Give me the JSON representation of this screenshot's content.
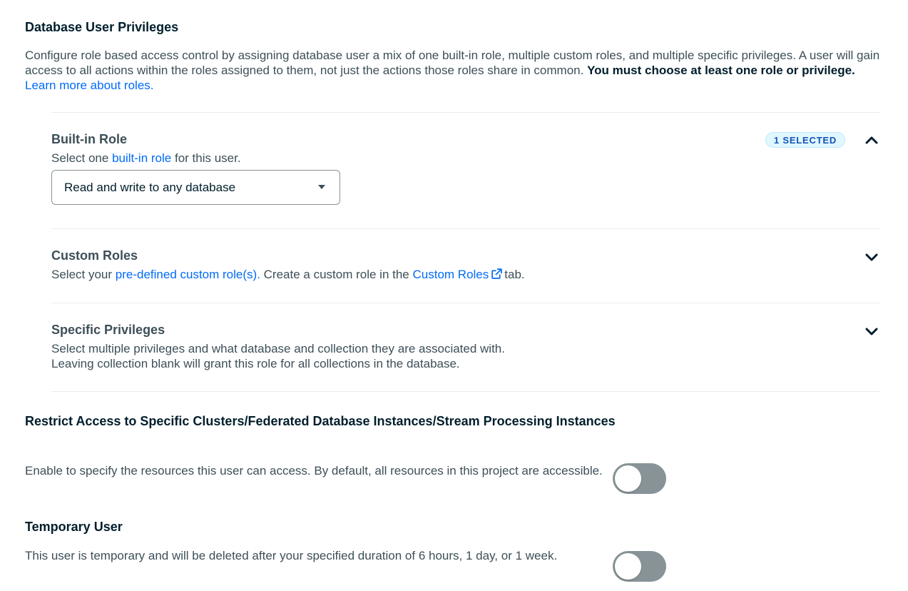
{
  "header": {
    "title": "Database User Privileges",
    "desc_part1": "Configure role based access control by assigning database user a mix of one built-in role, multiple custom roles, and multiple specific privileges. A user will gain access to all actions within the roles assigned to them, not just the actions those roles share in common.",
    "desc_bold": "You must choose at least one role or privilege.",
    "learn_more_link": "Learn more about roles."
  },
  "builtin_role": {
    "title": "Built-in Role",
    "badge": "1 SELECTED",
    "sub_prefix": "Select one",
    "sub_link": "built-in role",
    "sub_suffix": "for this user.",
    "select_value": "Read and write to any database",
    "expanded": true,
    "icon": "chevron-up-icon"
  },
  "custom_roles": {
    "title": "Custom Roles",
    "sub_prefix": "Select your",
    "sub_link": "pre-defined custom role(s).",
    "sub_middle": "Create a custom role in the",
    "sub_link2": "Custom Roles",
    "sub_suffix": "tab.",
    "expanded": false,
    "icon": "chevron-down-icon"
  },
  "specific_privileges": {
    "title": "Specific Privileges",
    "line1": "Select multiple privileges and what database and collection they are associated with.",
    "line2": "Leaving collection blank will grant this role for all collections in the database.",
    "expanded": false,
    "icon": "chevron-down-icon"
  },
  "restrict_access": {
    "title": "Restrict Access to Specific Clusters/Federated Database Instances/Stream Processing Instances",
    "desc": "Enable to specify the resources this user can access. By default, all resources in this project are accessible.",
    "enabled": false
  },
  "temporary_user": {
    "title": "Temporary User",
    "desc": "This user is temporary and will be deleted after your specified duration of 6 hours, 1 day, or 1 week.",
    "enabled": false
  },
  "colors": {
    "link": "#016bf8",
    "heading": "#001e2b",
    "body_text": "#3d4f58",
    "toggle_off": "#889397",
    "badge_bg": "#e1f7ff",
    "badge_text": "#1254b7"
  }
}
